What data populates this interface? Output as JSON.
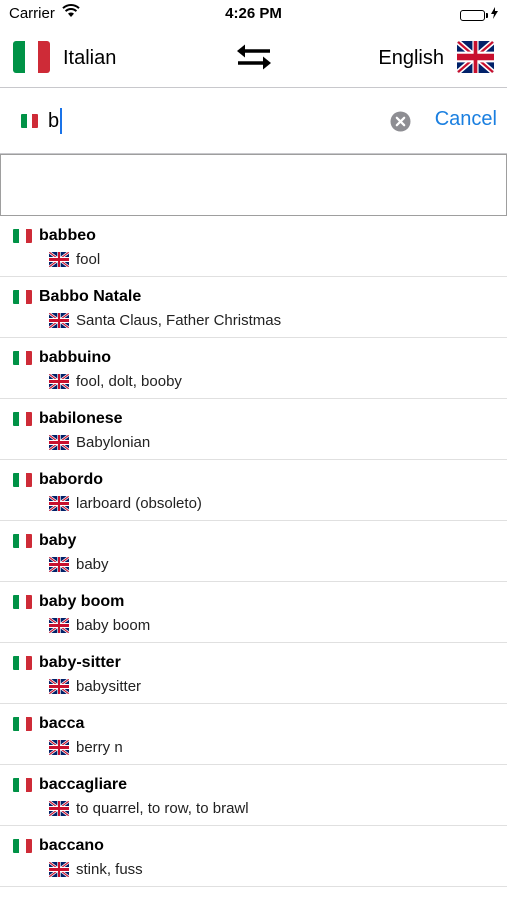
{
  "status_bar": {
    "carrier": "Carrier",
    "time": "4:26 PM",
    "battery_level": 1.0
  },
  "language_bar": {
    "source_language": "Italian",
    "target_language": "English",
    "source_flag_icon": "italy-flag-icon",
    "target_flag_icon": "uk-flag-icon",
    "swap_icon": "swap-arrows-icon"
  },
  "search": {
    "value": "b",
    "cancel_label": "Cancel"
  },
  "colors": {
    "accent": "#1a7fe0",
    "italy_green": "#009246",
    "italy_white": "#ffffff",
    "italy_red": "#ce2b37",
    "uk_blue": "#012169",
    "uk_red": "#c8102e"
  },
  "results": [
    {
      "term": "babbeo",
      "translation": "fool"
    },
    {
      "term": "Babbo Natale",
      "translation": "Santa Claus, Father Christmas"
    },
    {
      "term": "babbuino",
      "translation": "fool, dolt, booby"
    },
    {
      "term": "babilonese",
      "translation": "Babylonian"
    },
    {
      "term": "babordo",
      "translation": "larboard (obsoleto)"
    },
    {
      "term": "baby",
      "translation": "baby"
    },
    {
      "term": "baby boom",
      "translation": "baby boom"
    },
    {
      "term": "baby-sitter",
      "translation": "babysitter"
    },
    {
      "term": "bacca",
      "translation": "berry n"
    },
    {
      "term": "baccagliare",
      "translation": "to quarrel, to row, to brawl"
    },
    {
      "term": "baccano",
      "translation": "stink, fuss"
    }
  ]
}
